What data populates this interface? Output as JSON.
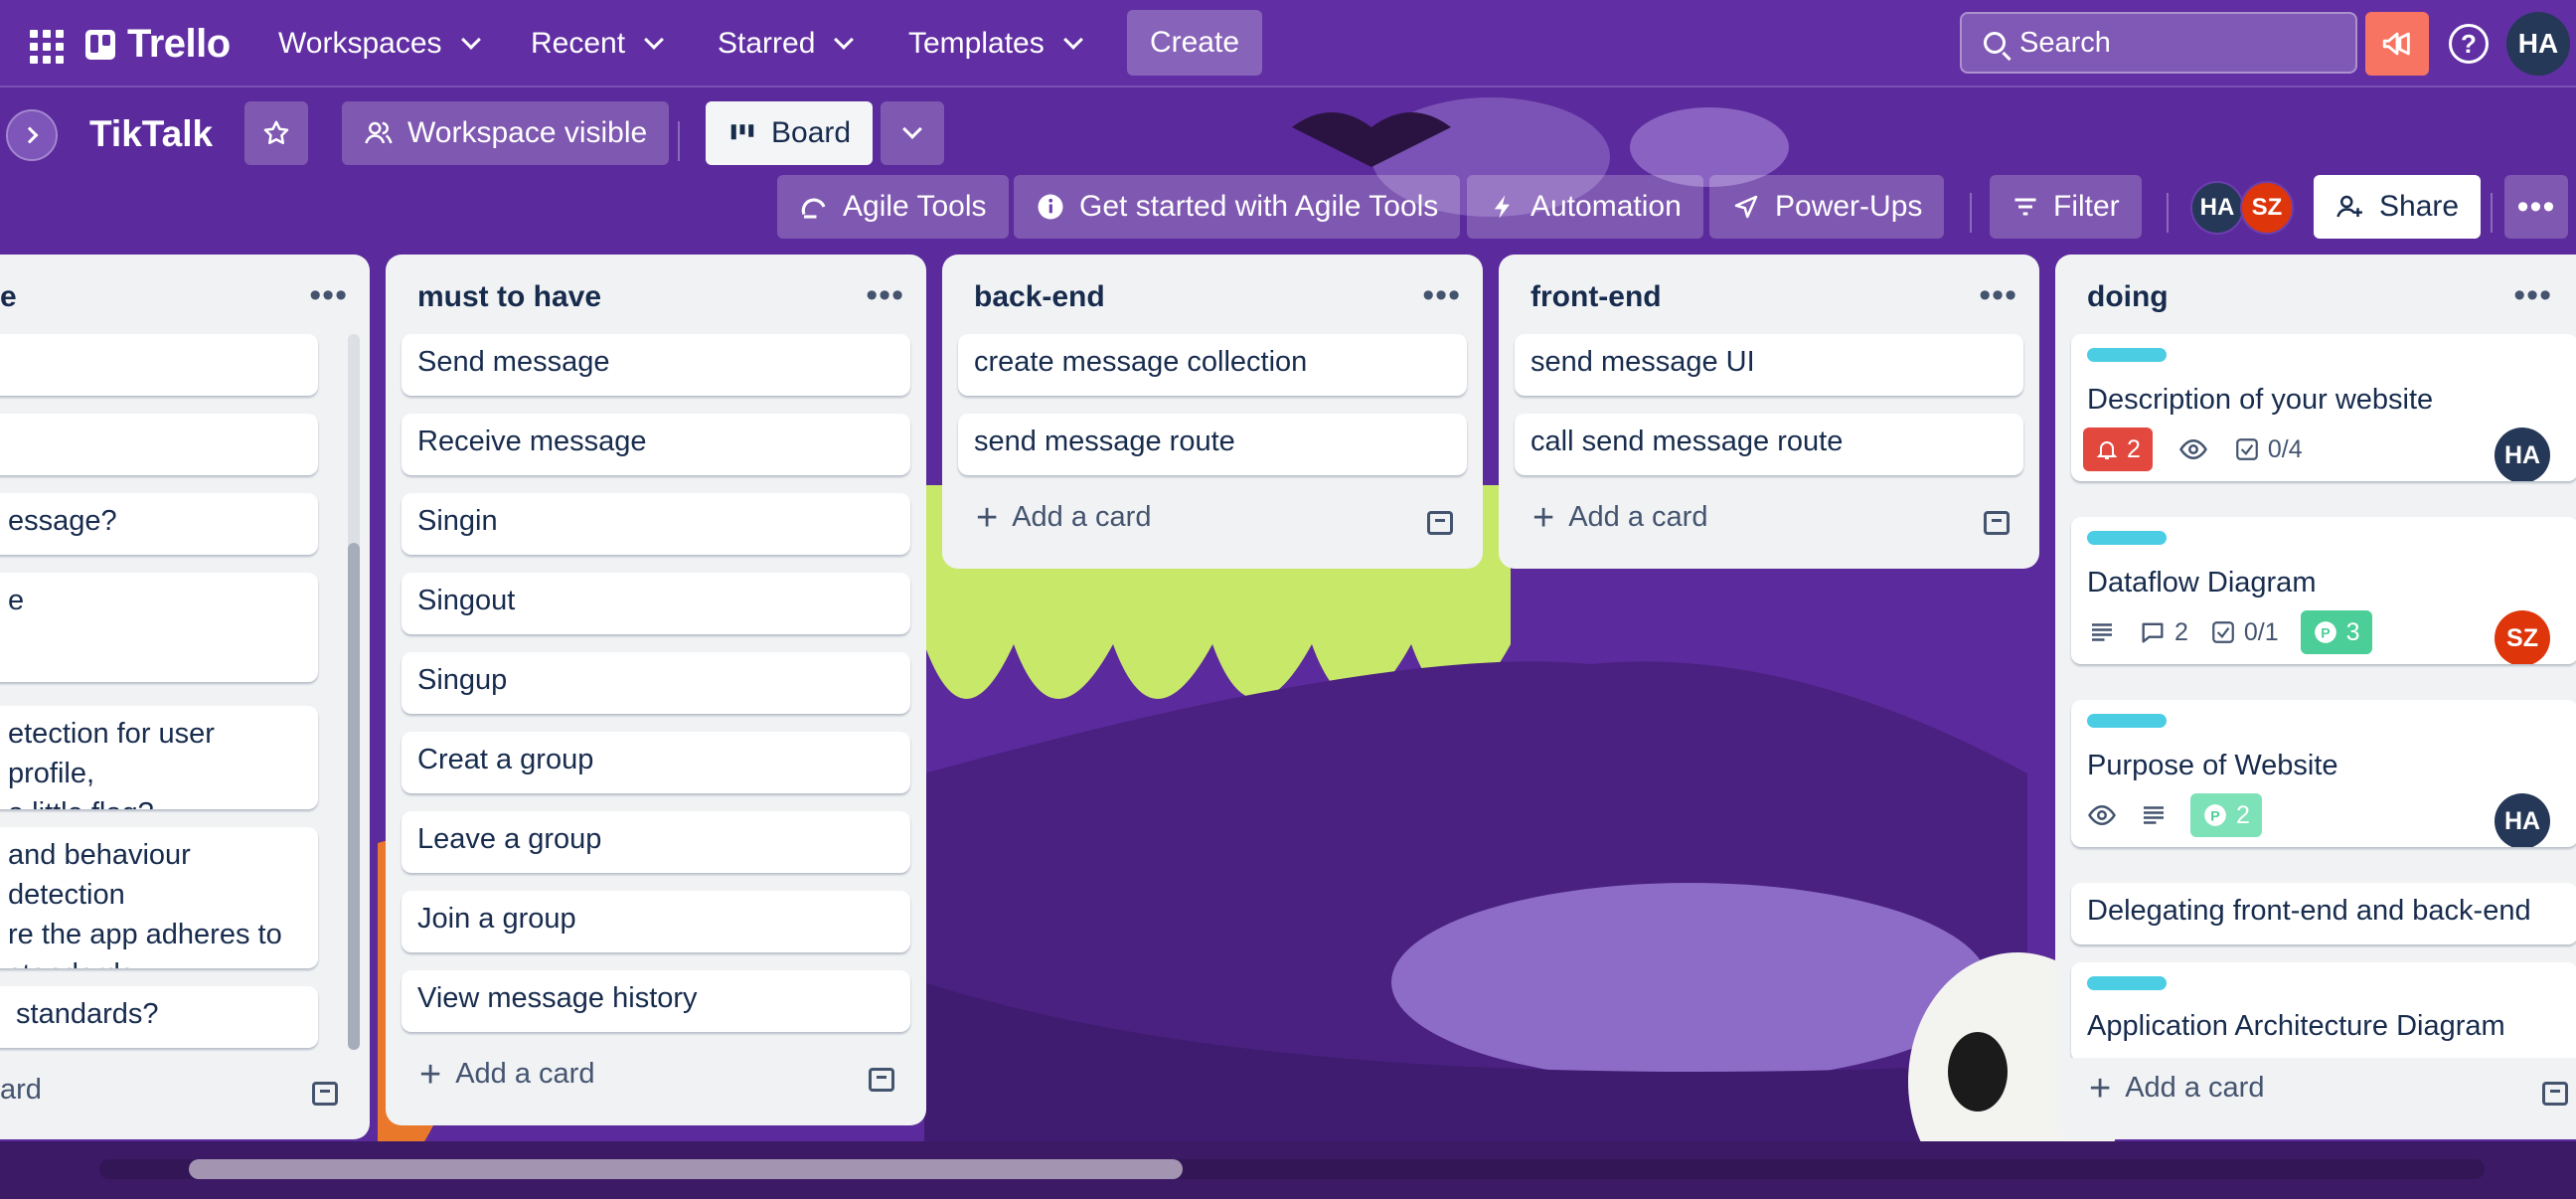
{
  "colors": {
    "topbar": "#612fa3",
    "board_bg": "#5b2a9c",
    "list_bg": "#f1f2f4",
    "label_cyan": "#4bcde4",
    "avatar_ha": "#253858",
    "avatar_sz": "#de350b",
    "badge_red": "#e2483d",
    "badge_green": "#4bce97",
    "notification": "#f87462"
  },
  "topbar": {
    "logo": "Trello",
    "nav": [
      "Workspaces",
      "Recent",
      "Starred",
      "Templates"
    ],
    "create_label": "Create",
    "search_placeholder": "Search",
    "icons": [
      "app-switcher-icon",
      "search-icon",
      "notification-icon",
      "help-icon"
    ],
    "user_initials": "HA"
  },
  "board": {
    "title": "TikTalk",
    "visibility_label": "Workspace visible",
    "view_label": "Board",
    "toolbar": {
      "agile_tools": "Agile Tools",
      "get_started": "Get started with Agile Tools",
      "automation": "Automation",
      "power_ups": "Power-Ups",
      "filter": "Filter",
      "share": "Share"
    },
    "members": [
      "HA",
      "SZ"
    ]
  },
  "lists": {
    "partial": {
      "title": "e",
      "cards": [
        "",
        "",
        "essage?",
        "e",
        "etection for user profile,\na little flag?",
        "and behaviour detection\nre the app adheres to\n standards",
        " standards?"
      ],
      "add_card": "ard"
    },
    "must_to_have": {
      "title": "must to have",
      "cards": [
        "Send message",
        "Receive message",
        "Singin",
        "Singout",
        "Singup",
        "Creat a group",
        "Leave a group",
        "Join a group",
        "View message history"
      ],
      "add_card": "Add a card"
    },
    "back_end": {
      "title": "back-end",
      "cards": [
        "create message collection",
        "send message route"
      ],
      "add_card": "Add a card"
    },
    "front_end": {
      "title": "front-end",
      "cards": [
        "send message UI",
        "call send message route"
      ],
      "add_card": "Add a card"
    },
    "doing": {
      "title": "doing",
      "cards": [
        {
          "title": "Description of your website",
          "notifications": "2",
          "checklist": "0/4",
          "member": "HA"
        },
        {
          "title": "Dataflow Diagram",
          "comments": "2",
          "checklist": "0/1",
          "points": "3",
          "member": "SZ"
        },
        {
          "title": "Purpose of Website",
          "points": "2",
          "member": "HA"
        },
        {
          "title": "Delegating front-end and back-end"
        },
        {
          "title": "Application Architecture Diagram"
        }
      ],
      "add_card": "Add a card"
    }
  },
  "horizontal_scroll_fraction": 0.37
}
